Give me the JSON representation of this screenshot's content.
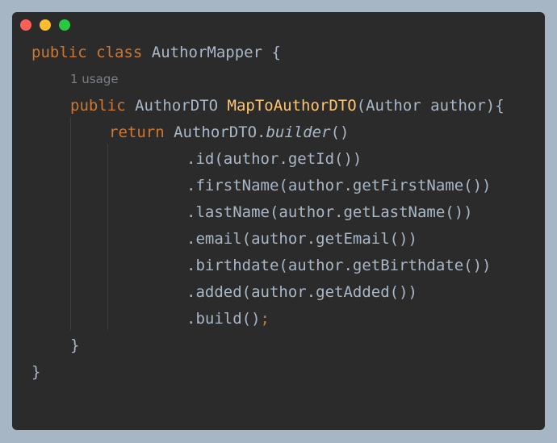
{
  "window": {
    "buttons": [
      {
        "name": "close",
        "color": "#ff5f57"
      },
      {
        "name": "minimize",
        "color": "#febc2e"
      },
      {
        "name": "maximize",
        "color": "#28c840"
      }
    ]
  },
  "colors": {
    "background": "#2b2b2b",
    "keyword": "#cc7832",
    "function": "#ffc66d",
    "text": "#a9b7c6",
    "hint": "#7a7e85"
  },
  "code": {
    "l1": {
      "kw1": "public",
      "kw2": "class",
      "name": "AuthorMapper",
      "brace": "{"
    },
    "usage_hint": "1 usage",
    "l2": {
      "kw": "public",
      "type": "AuthorDTO",
      "method": "MapToAuthorDTO",
      "params": "(Author author){"
    },
    "l3": {
      "kw": "return",
      "type": "AuthorDTO.",
      "call": "builder",
      "parens": "()"
    },
    "chain": [
      ".id(author.getId())",
      ".firstName(author.getFirstName())",
      ".lastName(author.getLastName())",
      ".email(author.getEmail())",
      ".birthdate(author.getBirthdate())",
      ".added(author.getAdded())"
    ],
    "build": {
      "call": ".build()",
      "semi": ";"
    },
    "close_method": "}",
    "close_class": "}"
  }
}
